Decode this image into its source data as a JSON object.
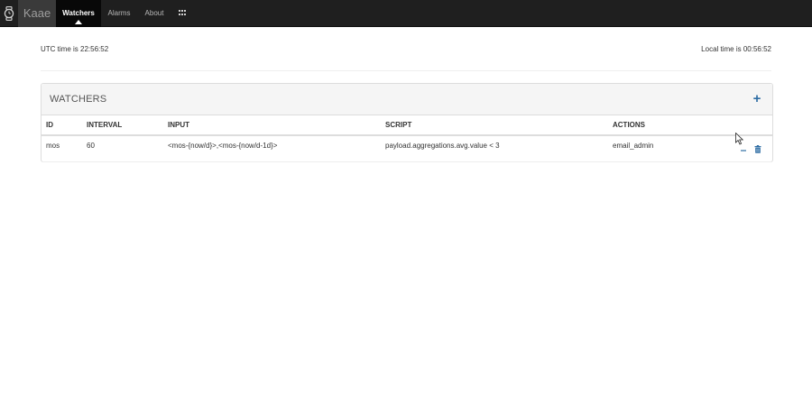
{
  "app": {
    "brand": "Kaae"
  },
  "nav": {
    "items": [
      {
        "label": "Watchers",
        "active": true
      },
      {
        "label": "Alarms",
        "active": false
      },
      {
        "label": "About",
        "active": false
      }
    ],
    "grid_icon": "grid-icon"
  },
  "times": {
    "utc": "UTC time is 22:56:52",
    "local": "Local time is 00:56:52"
  },
  "panel": {
    "title": "WATCHERS",
    "add_icon": "+",
    "columns": [
      "ID",
      "INTERVAL",
      "INPUT",
      "SCRIPT",
      "ACTIONS"
    ],
    "rows": [
      {
        "id": "mos",
        "interval": "60",
        "input": "<mos-{now/d}>,<mos-{now/d-1d}>",
        "script": "payload.aggregations.avg.value < 3",
        "actions": "email_admin"
      }
    ]
  },
  "colors": {
    "navbar": "#1f1f1f",
    "accent": "#2e6da4"
  }
}
